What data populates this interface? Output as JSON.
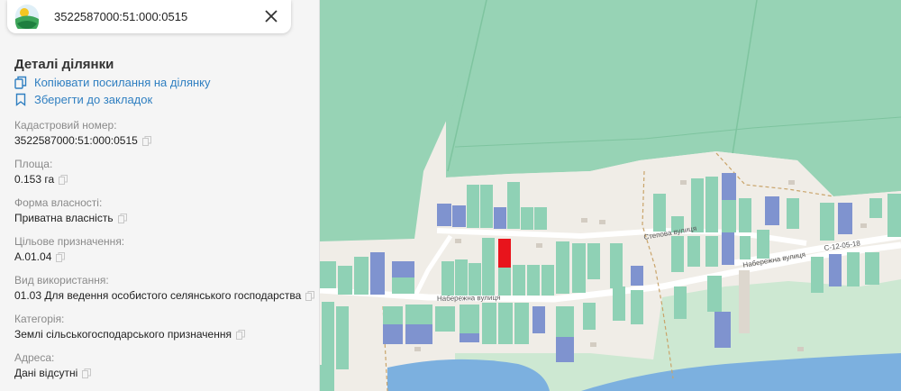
{
  "search": {
    "query": "3522587000:51:000:0515"
  },
  "details": {
    "title": "Деталі ділянки",
    "copy_link_label": "Копіювати посилання на ділянку",
    "bookmark_label": "Зберегти до закладок",
    "fields": [
      {
        "label": "Кадастровий номер:",
        "value": "3522587000:51:000:0515"
      },
      {
        "label": "Площа:",
        "value": "0.153 га"
      },
      {
        "label": "Форма власності:",
        "value": "Приватна власність"
      },
      {
        "label": "Цільове призначення:",
        "value": "A.01.04"
      },
      {
        "label": "Вид використання:",
        "value": "01.03 Для ведення особистого селянського господарства"
      },
      {
        "label": "Категорія:",
        "value": "Землі сільськогосподарського призначення"
      },
      {
        "label": "Адреса:",
        "value": "Дані відсутні"
      }
    ]
  },
  "map": {
    "streets": {
      "naberezhna_1": "Набережна вулиця",
      "stepova": "Степова вулиця",
      "naberezhna_2": "Набережна вулиця",
      "road_code": "С-12-05-18"
    },
    "colors": {
      "field": "#97d3b5",
      "parcel_green": "#8fd1b5",
      "parcel_blue": "#7f93cf",
      "selected_parcel": "#e8141c",
      "water": "#7cb0df",
      "road": "#ffffff",
      "link": "#2f7fc1"
    }
  },
  "icons": [
    "logo-icon",
    "close-icon",
    "copy-link-icon",
    "bookmark-icon",
    "copy-icon"
  ]
}
